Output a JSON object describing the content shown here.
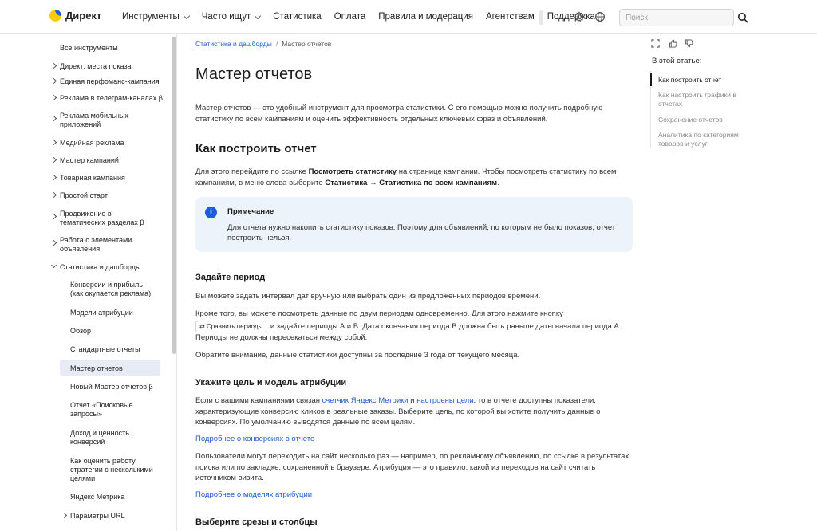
{
  "header": {
    "logo_text": "Директ",
    "nav": [
      "Инструменты",
      "Часто ищут",
      "Статистика",
      "Оплата",
      "Правила и модерация",
      "Агентствам",
      "Поддержка"
    ],
    "search_placeholder": "Поиск"
  },
  "sidebar": {
    "all_tools": "Все инструменты",
    "items": [
      "Директ: места показа",
      "Единая перфоманс-кампания",
      "Реклама в телеграм-каналах β",
      "Реклама мобильных приложений",
      "Медийная реклама",
      "Мастер кампаний",
      "Товарная кампания",
      "Простой старт",
      "Продвижение в тематических разделах β",
      "Работа с элементами объявления",
      "Статистика и дашборды"
    ],
    "sub_items": [
      "Конверсии и прибыль (как окупается реклама)",
      "Модели атрибуции",
      "Обзор",
      "Стандартные отчеты",
      "Мастер отчетов",
      "Новый Мастер отчетов β",
      "Отчет «Поисковые запросы»",
      "Доход и ценность конверсий",
      "Как оценить работу стратегии с несколькими целями",
      "Яндекс Метрика",
      "Параметры URL"
    ]
  },
  "breadcrumb": {
    "parent": "Статистика и дашборды",
    "separator": "/",
    "current": "Мастер отчетов"
  },
  "article": {
    "title": "Мастер отчетов",
    "intro": "Мастер отчетов — это удобный инструмент для просмотра статистики. С его помощью можно получить подробную статистику по всем кампаниям и оценить эффективность отдельных ключевых фраз и объявлений.",
    "h2": "Как построить отчет",
    "p1_a": "Для этого перейдите по ссылке ",
    "p1_b": "Посмотреть статистику",
    "p1_c": " на странице кампании. Чтобы посмотреть статистику по всем кампаниям, в меню слева выберите ",
    "p1_d": "Статистика → Статистика по всем кампаниям",
    "p1_e": ".",
    "note_title": "Примечание",
    "note_text": "Для отчета нужно накопить статистику показов. Поэтому для объявлений, по которым не было показов, отчет построить нельзя.",
    "h3_period": "Задайте период",
    "period_p1": "Вы можете задать интервал дат вручную или выбрать один из предложенных периодов времени.",
    "period_p2_a": "Кроме того, вы можете посмотреть данные по двум периодам одновременно. Для этого нажмите кнопку",
    "compare_button": "Сравнить периоды",
    "period_p2_b": " и задайте периоды А и В. Дата окончания периода В должна быть раньше даты начала периода А. Периоды не должны пересекаться между собой.",
    "period_p3": "Обратите внимание, данные статистики доступны за последние 3 года от текущего месяца.",
    "h3_goal": "Укажите цель и модель атрибуции",
    "goal_p1_a": "Если с вашими кампаниями связан ",
    "goal_p1_link1": "счетчик Яндекс Метрики",
    "goal_p1_b": " и ",
    "goal_p1_link2": "настроены цели",
    "goal_p1_c": ", то в отчете доступны показатели, характеризующие конверсию кликов в реальные заказы. Выберите цель, по которой вы хотите получить данные о конверсиях. По умолчанию выводятся данные по всем целям.",
    "more_conversions": "Подробнее о конверсиях в отчете",
    "goal_p2": "Пользователи могут переходить на сайт несколько раз — например, по рекламному объявлению, по ссылке в результатах поиска или по закладке, сохраненной в браузере. Атрибуция — это правило, какой из переходов на сайт считать источником визита.",
    "more_models": "Подробнее о моделях атрибуции",
    "h3_slices": "Выберите срезы и столбцы"
  },
  "toc": {
    "title": "В этой статье:",
    "items": [
      "Как построить отчет",
      "Как настроить графики в отчетах",
      "Сохранение отчетов",
      "Аналитика по категориям товаров и услуг"
    ]
  },
  "colors": {
    "accent": "#1e5bd6",
    "note_bg": "#edf3fb",
    "active_bg": "#e6ebf5",
    "logo_yellow": "#ffcc00"
  }
}
